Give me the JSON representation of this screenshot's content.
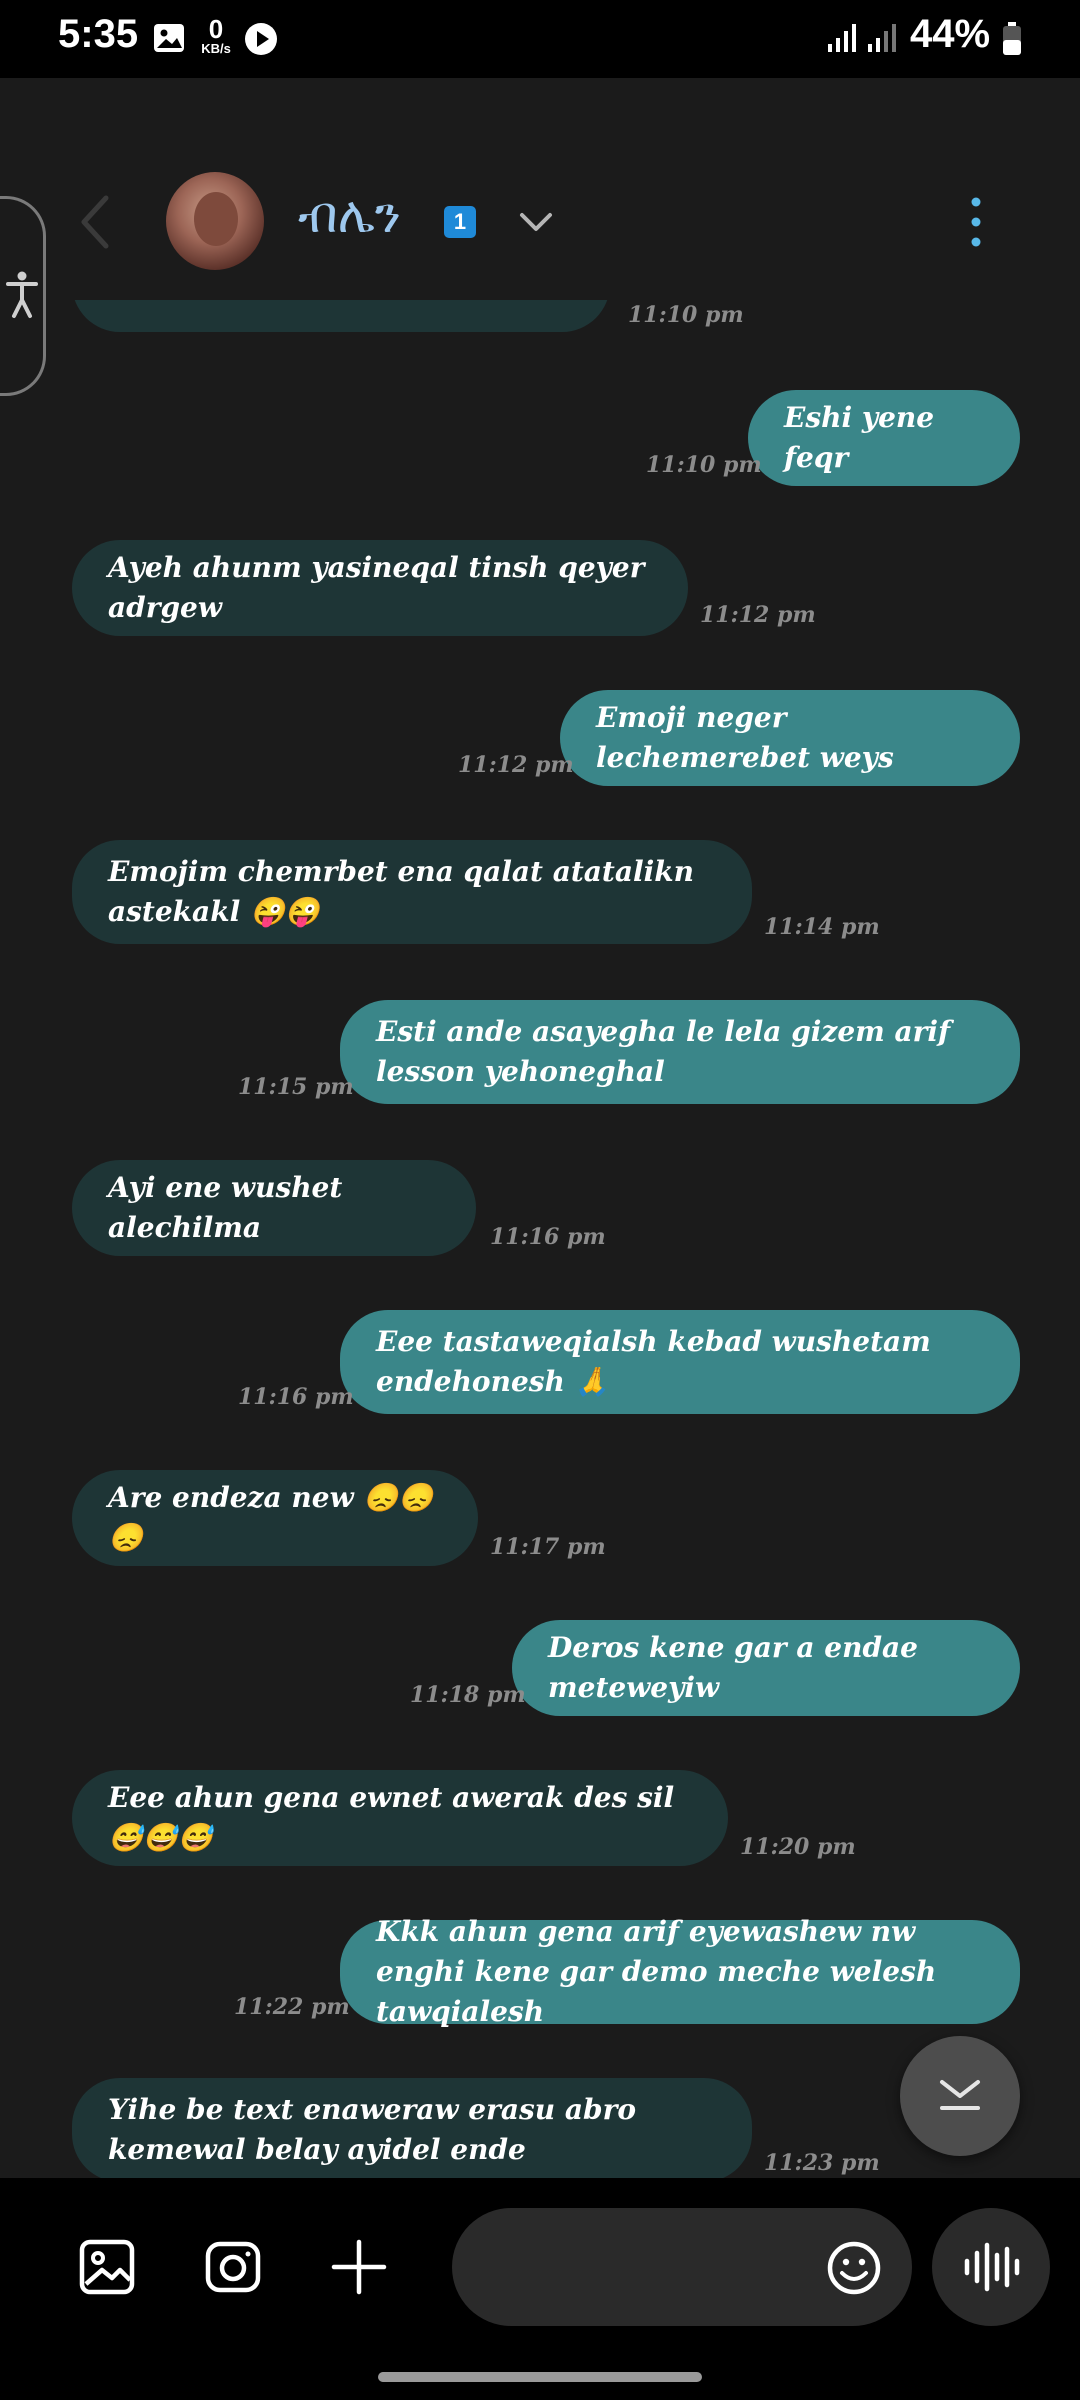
{
  "status_bar": {
    "time": "5:35",
    "net_speed_value": "0",
    "net_speed_unit": "KB/s",
    "battery": "44%"
  },
  "header": {
    "contact_name": "ብሌን",
    "badge_count": "1"
  },
  "messages": [
    {
      "dir": "in",
      "text": "",
      "time": "11:10 pm"
    },
    {
      "dir": "out",
      "text": "Eshi yene feqr",
      "time": "11:10 pm"
    },
    {
      "dir": "in",
      "text": "Ayeh ahunm yasineqal tinsh qeyer adrgew",
      "time": "11:12 pm"
    },
    {
      "dir": "out",
      "text": "Emoji neger lechemerebet weys",
      "time": "11:12 pm"
    },
    {
      "dir": "in",
      "text": "Emojim chemrbet ena qalat atatalikn astekakl 😜😜",
      "time": "11:14 pm"
    },
    {
      "dir": "out",
      "text": "Esti ande asayegha le lela gizem arif lesson yehoneghal",
      "time": "11:15 pm"
    },
    {
      "dir": "in",
      "text": "Ayi ene wushet alechilma",
      "time": "11:16 pm"
    },
    {
      "dir": "out",
      "text": "Eee tastaweqialsh kebad wushetam endehonesh 🙏",
      "time": "11:16 pm"
    },
    {
      "dir": "in",
      "text": "Are endeza new 😞😞😞",
      "time": "11:17 pm"
    },
    {
      "dir": "out",
      "text": "Deros kene gar a endae meteweyiw",
      "time": "11:18 pm"
    },
    {
      "dir": "in",
      "text": "Eee ahun gena ewnet awerak des sil 😅😅😅",
      "time": "11:20 pm"
    },
    {
      "dir": "out",
      "text": "Kkk ahun gena arif eyewashew nw enghi kene gar demo meche welesh tawqialesh",
      "time": "11:22 pm"
    },
    {
      "dir": "in",
      "text": "Yihe be text enaweraw erasu abro kemewal belay ayidel ende",
      "time": "11:23 pm"
    }
  ],
  "icons": {
    "status": [
      "gallery-notification-icon",
      "play-icon",
      "signal-icon",
      "battery-icon"
    ],
    "header": [
      "accessibility-icon",
      "back-icon",
      "chevron-down-icon",
      "more-vertical-icon"
    ],
    "input": [
      "gallery-icon",
      "camera-icon",
      "plus-icon",
      "emoji-icon",
      "voice-wave-icon"
    ],
    "scroll": "scroll-down-icon"
  },
  "colors": {
    "background": "#1b1b1b",
    "incoming_bubble": "#1e3536",
    "outgoing_bubble": "#3a8689",
    "contact_name": "#9ec8ee",
    "badge": "#1f8ad8",
    "timestamp": "#8c8c8c"
  }
}
